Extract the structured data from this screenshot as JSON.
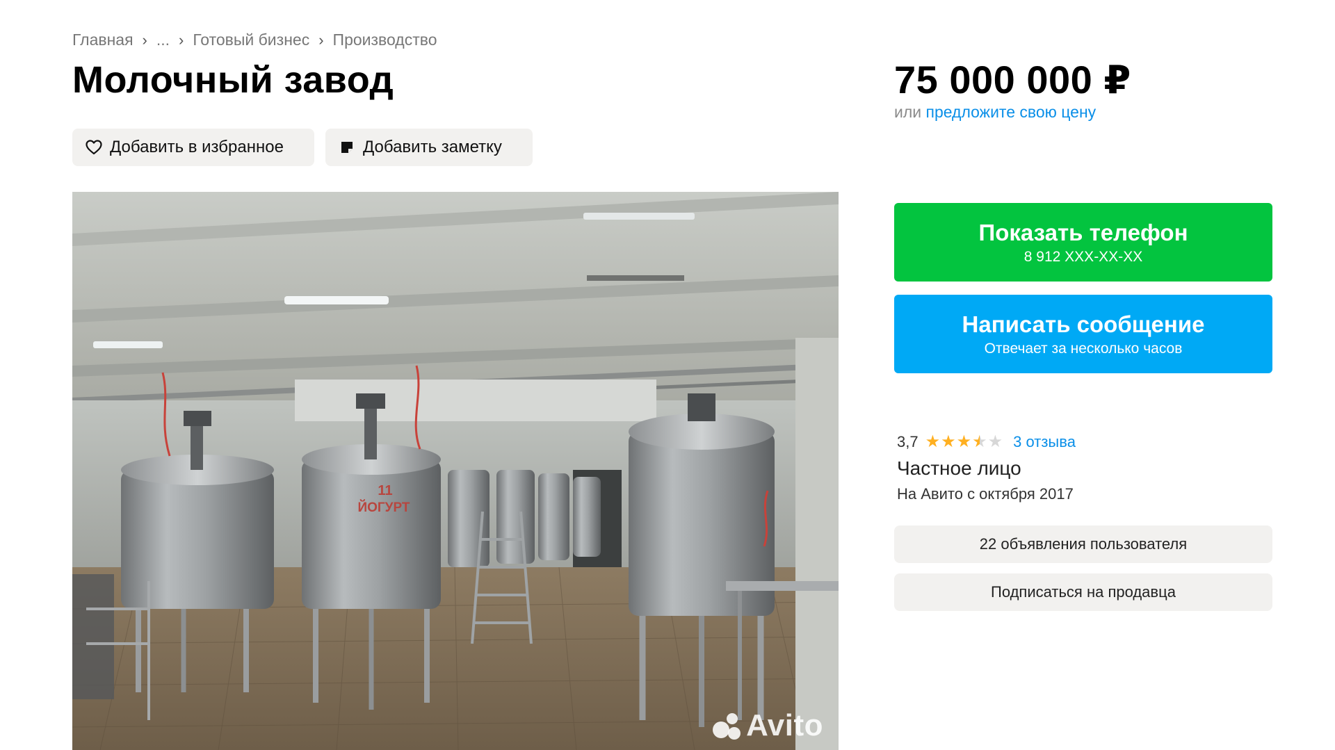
{
  "breadcrumb": {
    "items": [
      "Главная",
      "...",
      "Готовый бизнес",
      "Производство"
    ],
    "separator": "›"
  },
  "listing": {
    "title": "Молочный завод",
    "favorite_label": "Добавить в избранное",
    "note_label": "Добавить заметку"
  },
  "photo": {
    "tank_label_number": "11",
    "tank_label_text": "ЙОГУРТ",
    "watermark": "Avito"
  },
  "price": {
    "amount": "75 000 000 ₽",
    "offer_prefix": "или",
    "offer_link": "предложите свою цену"
  },
  "contact": {
    "phone_button": "Показать телефон",
    "phone_masked": "8 912 XXX-XX-XX",
    "message_button": "Написать сообщение",
    "message_sub": "Отвечает за несколько часов"
  },
  "seller": {
    "rating": "3,7",
    "rating_value": 3.7,
    "rating_max": 5,
    "reviews_link": "3 отзыва",
    "type": "Частное лицо",
    "since": "На Авито с октября 2017",
    "listings_button": "22 объявления пользователя",
    "subscribe_button": "Подписаться на продавца"
  },
  "colors": {
    "phone_button": "#03c43f",
    "message_button": "#00a9f5",
    "link": "#0a8fe8",
    "star": "#ffb021",
    "grey_button": "#f2f1ef"
  }
}
